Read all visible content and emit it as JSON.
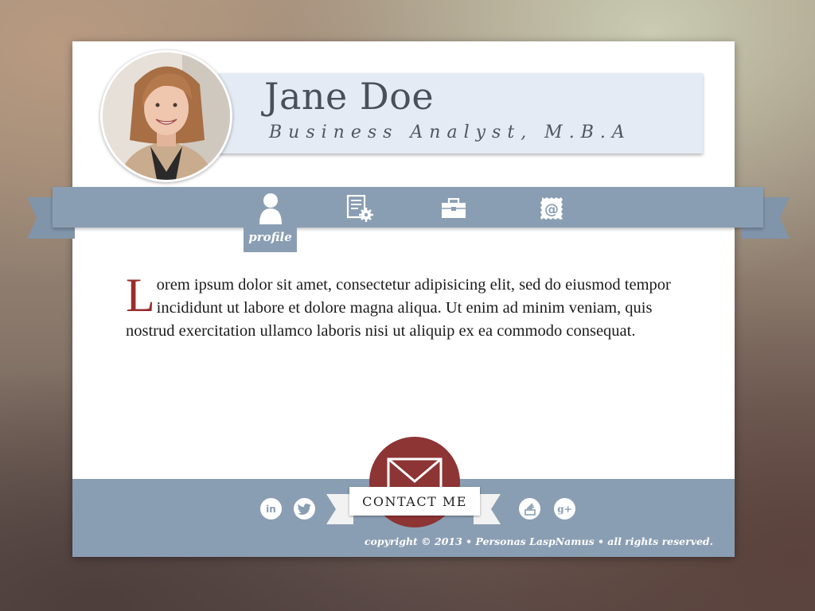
{
  "profile": {
    "name": "Jane Doe",
    "title": "Business Analyst, M.B.A"
  },
  "nav": {
    "items": [
      {
        "icon": "user-icon",
        "label": "profile",
        "active": true
      },
      {
        "icon": "resume-settings-icon",
        "label": "",
        "active": false
      },
      {
        "icon": "briefcase-icon",
        "label": "",
        "active": false
      },
      {
        "icon": "email-stamp-icon",
        "label": "",
        "active": false
      }
    ]
  },
  "intro": {
    "dropcap": "L",
    "text": "orem ipsum dolor sit amet, consectetur adipisicing elit, sed do eiusmod tempor incididunt ut labore et dolore magna aliqua. Ut enim ad minim veniam, quis nostrud exercitation ullamco laboris nisi ut aliquip ex ea commodo consequat."
  },
  "footer": {
    "contact_label": "CONTACT ME",
    "social": [
      {
        "icon": "linkedin-icon",
        "glyph": "in"
      },
      {
        "icon": "twitter-icon",
        "glyph": ""
      },
      {
        "icon": "stumbleupon-icon",
        "glyph": ""
      },
      {
        "icon": "google-plus-icon",
        "glyph": "g+"
      }
    ],
    "copyright": "copyright © 2013 • Personas LaspNamus • all rights reserved."
  },
  "colors": {
    "ribbon": "#8a9eb3",
    "name_box": "#e4ebf4",
    "accent_red": "#8d3434",
    "dropcap": "#9a2d2d"
  }
}
